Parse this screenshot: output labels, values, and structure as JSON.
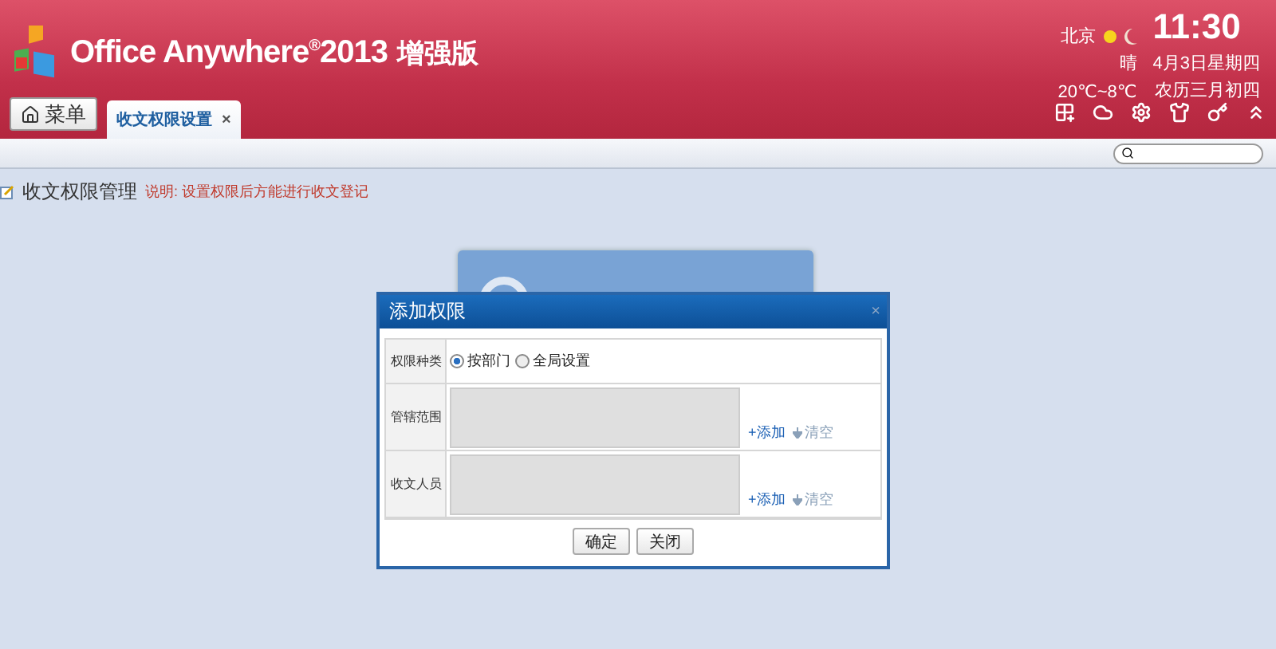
{
  "header": {
    "logo_title": "Office Anywhere$^{®}$2013",
    "logo_edition": "增强版"
  },
  "weather": {
    "city": "北京",
    "condition": "晴",
    "temperature": "20℃~8℃"
  },
  "clock": {
    "time": "11:30",
    "date": "4月3日星期四",
    "lunar_date": "农历三月初四"
  },
  "menu_button": "菜单",
  "tabs": [
    {
      "label": "收文权限设置",
      "close": "×",
      "selected": true
    }
  ],
  "page": {
    "title": "收文权限管理",
    "note": "说明: 设置权限后方能进行收文登记"
  },
  "dialog": {
    "title": "添加权限",
    "close": "×",
    "rows": [
      {
        "kind": "radio",
        "label": "权限种类",
        "options": [
          {
            "label": "按部门",
            "selected": true
          },
          {
            "label": "全局设置",
            "selected": false
          }
        ]
      },
      {
        "kind": "picker",
        "label": "管辖范围",
        "add": "+添加",
        "clear": "清空"
      },
      {
        "kind": "picker",
        "label": "收文人员",
        "add": "+添加",
        "clear": "清空"
      }
    ],
    "buttons": [
      "确定",
      "关闭"
    ]
  }
}
